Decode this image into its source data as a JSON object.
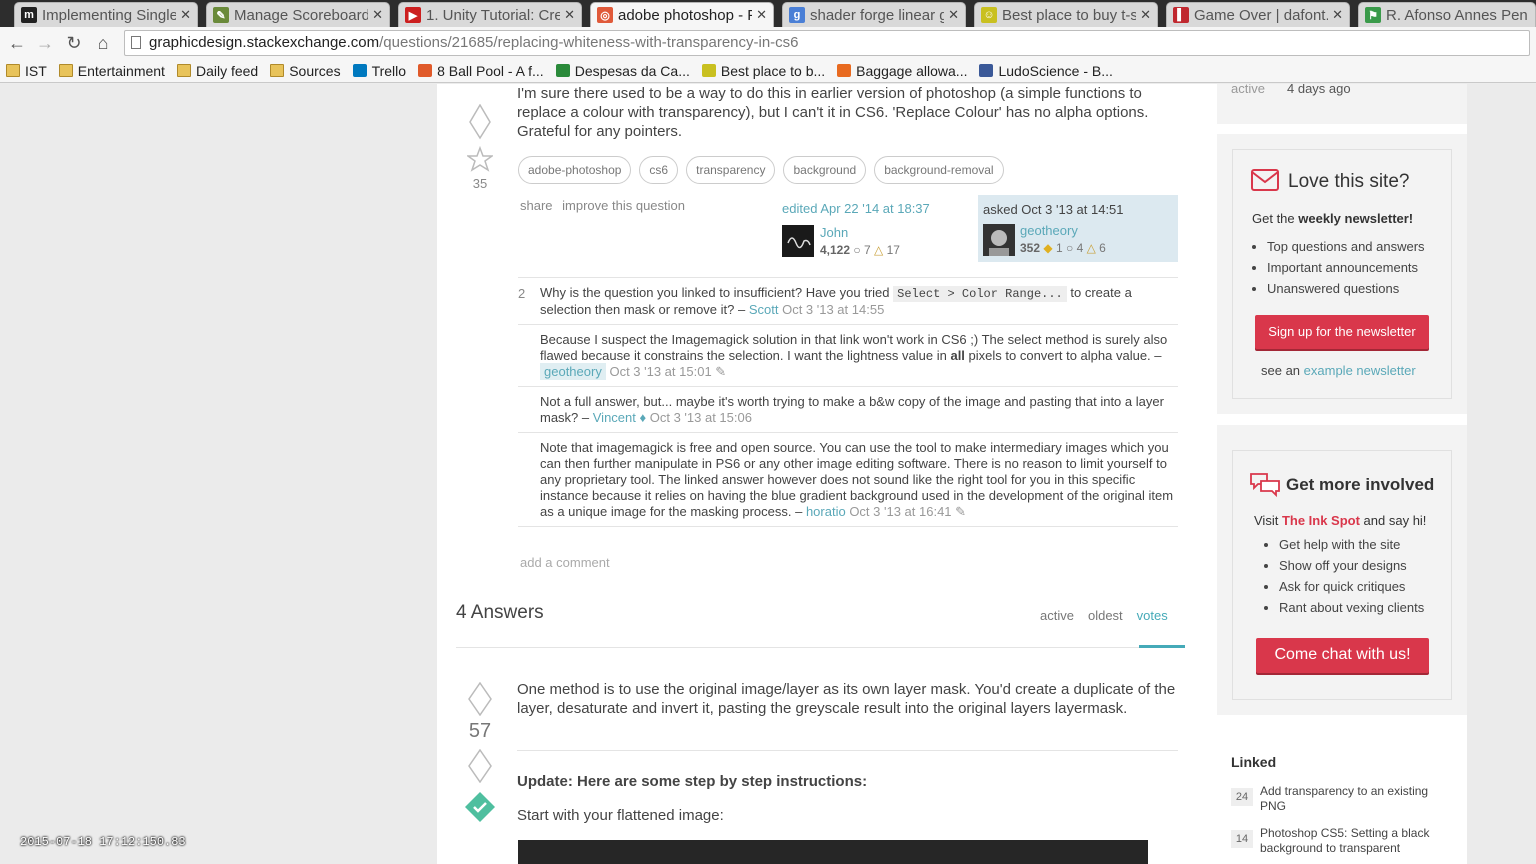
{
  "browser": {
    "tabs": [
      {
        "title": "Implementing Single",
        "fav_color": "#222",
        "fav_glyph": "m"
      },
      {
        "title": "Manage Scoreboard",
        "fav_color": "#6a8a3a",
        "fav_glyph": "✎"
      },
      {
        "title": "1. Unity Tutorial: Cre",
        "fav_color": "#cc1f1f",
        "fav_glyph": "▶"
      },
      {
        "title": "adobe photoshop - F",
        "fav_color": "#e05a3a",
        "fav_glyph": "◎"
      },
      {
        "title": "shader forge linear g",
        "fav_color": "#4a7fd6",
        "fav_glyph": "g"
      },
      {
        "title": "Best place to buy t-sh",
        "fav_color": "#c9c020",
        "fav_glyph": "☺"
      },
      {
        "title": "Game Over | dafont.c",
        "fav_color": "#c0282f",
        "fav_glyph": "▌"
      },
      {
        "title": "R. Afonso Annes Pen",
        "fav_color": "#3a9a4a",
        "fav_glyph": "⚑"
      }
    ],
    "url_host": "graphicdesign.stackexchange.com",
    "url_path": "/questions/21685/replacing-whiteness-with-transparency-in-cs6",
    "bookmarks": [
      {
        "label": "IST",
        "kind": "folder"
      },
      {
        "label": "Entertainment",
        "kind": "folder"
      },
      {
        "label": "Daily feed",
        "kind": "folder"
      },
      {
        "label": "Sources",
        "kind": "folder"
      },
      {
        "label": "Trello",
        "kind": "site"
      },
      {
        "label": "8 Ball Pool - A f...",
        "kind": "site"
      },
      {
        "label": "Despesas da Ca...",
        "kind": "site"
      },
      {
        "label": "Best place to b...",
        "kind": "site"
      },
      {
        "label": "Baggage allowa...",
        "kind": "site"
      },
      {
        "label": "LudoScience - B...",
        "kind": "site"
      }
    ]
  },
  "question": {
    "votes": "35",
    "body": "I'm sure there used to be a way to do this in earlier version of photoshop (a simple functions to replace a colour with transparency), but I can't it in CS6. 'Replace Colour' has no alpha options. Grateful for any pointers.",
    "tags": [
      "adobe-photoshop",
      "cs6",
      "transparency",
      "background",
      "background-removal"
    ],
    "share": "share",
    "improve": "improve this question",
    "edited": {
      "label": "edited Apr 22 '14 at 18:37",
      "user": "John",
      "rep": "4,122",
      "silver": "7",
      "bronze": "17"
    },
    "asked": {
      "label": "asked Oct 3 '13 at 14:51",
      "user": "geotheory",
      "rep": "352",
      "gold": "1",
      "silver": "4",
      "bronze": "6"
    }
  },
  "comments": [
    {
      "score": "2",
      "pre": "Why is the question you linked to insufficient? Have you tried ",
      "code": "Select > Color Range...",
      "post": " to create a selection then mask or remove it? – ",
      "user": "Scott",
      "date": "Oct 3 '13 at 14:55"
    },
    {
      "score": "",
      "pre": "Because I suspect the Imagemagick solution in that link won't work in CS6 ;) The select method is surely also flawed because it constrains the selection. I want the lightness value in ",
      "bold": "all",
      "post": " pixels to convert to alpha value. – ",
      "user": "geotheory",
      "date": "Oct 3 '13 at 15:01"
    },
    {
      "score": "",
      "pre": "Not a full answer, but... maybe it's worth trying to make a b&w copy of the image and pasting that into a layer mask? – ",
      "user": "Vincent ♦",
      "date": "Oct 3 '13 at 15:06"
    },
    {
      "score": "",
      "pre": "Note that imagemagick is free and open source. You can use the tool to make intermediary images which you can then further manipulate in PS6 or any other image editing software. There is no reason to limit yourself to any proprietary tool. The linked answer however does not sound like the right tool for you in this specific instance because it relies on having the blue gradient background used in the development of the original item as a unique image for the masking process. – ",
      "user": "horatio",
      "date": "Oct 3 '13 at 16:41"
    }
  ],
  "add_comment": "add a comment",
  "answers": {
    "heading": "4 Answers",
    "sort_tabs": [
      "active",
      "oldest",
      "votes"
    ],
    "first": {
      "votes": "57",
      "body": "One method is to use the original image/layer as its own layer mask. You'd create a duplicate of the layer, desaturate and invert it, pasting the greyscale result into the original layers layermask.",
      "update": "Update: Here are some step by step instructions:",
      "step1": "Start with your flattened image:"
    }
  },
  "sidebar": {
    "stats": {
      "label": "active",
      "value": "4 days ago"
    },
    "newsletter": {
      "title": "Love this site?",
      "lead": "Get the ",
      "lead_bold": "weekly newsletter!",
      "items": [
        "Top questions and answers",
        "Important announcements",
        "Unanswered questions"
      ],
      "button": "Sign up for the newsletter",
      "see_pre": "see an ",
      "see_link": "example newsletter"
    },
    "involved": {
      "title": "Get more involved",
      "lead_pre": "Visit ",
      "lead_link": "The Ink Spot",
      "lead_post": " and say hi!",
      "items": [
        "Get help with the site",
        "Show off your designs",
        "Ask for quick critiques",
        "Rant about vexing clients"
      ],
      "button": "Come chat with us!"
    },
    "linked": {
      "title": "Linked",
      "items": [
        {
          "count": "24",
          "title": "Add transparency to an existing PNG"
        },
        {
          "count": "14",
          "title": "Photoshop CS5: Setting a black background to transparent"
        }
      ]
    }
  },
  "overlay_timestamp": "2015-07-18 17:12:150.83",
  "colors": {
    "accent": "#45aab8",
    "brand_red": "#d9374b",
    "accepted": "#4fbf9f"
  }
}
